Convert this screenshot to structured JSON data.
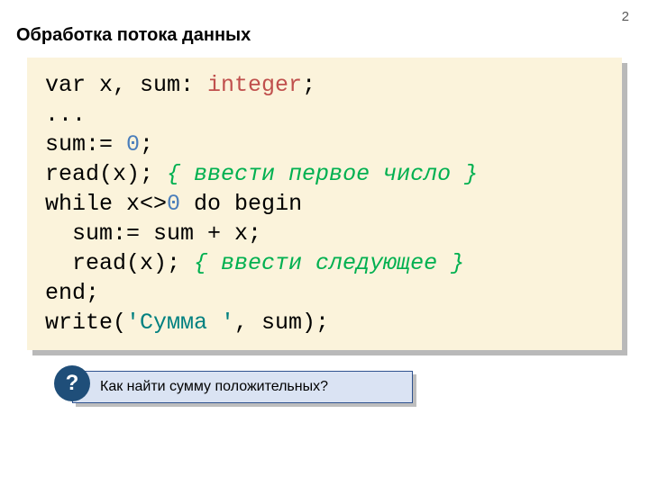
{
  "page_number": "2",
  "title": "Обработка потока данных",
  "code": {
    "line1": {
      "a": "var x, sum: ",
      "b": "integer",
      "c": ";"
    },
    "line2": "...",
    "line3": {
      "a": "sum:= ",
      "b": "0",
      "c": ";"
    },
    "line4": {
      "a": "read(x); ",
      "b": "{ ввести первое число }"
    },
    "line5": {
      "a": "while x<>",
      "b": "0",
      "c": " do begin"
    },
    "line6": "  sum:= sum + x;",
    "line7": {
      "a": "  read(x); ",
      "b": "{ ввести следующее }"
    },
    "line8": "end;",
    "line9": {
      "a": "write(",
      "b": "'Сумма '",
      "c": ", sum);"
    }
  },
  "badge_label": "?",
  "callout_text": "Как найти сумму положительных?"
}
